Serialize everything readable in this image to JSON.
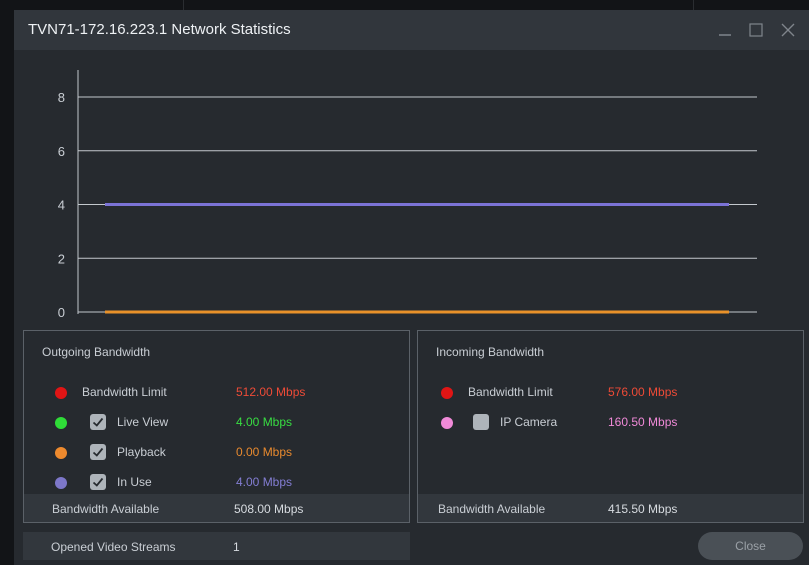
{
  "window": {
    "title": "TVN71-172.16.223.1 Network Statistics",
    "controls": [
      "minimize-icon",
      "maximize-icon",
      "close-icon"
    ]
  },
  "chart_data": {
    "type": "line",
    "x": [
      0,
      1,
      2,
      3,
      4,
      5,
      6,
      7,
      8,
      9,
      10,
      11,
      12,
      13,
      14,
      15,
      16,
      17,
      18,
      19,
      20
    ],
    "ylim": [
      0,
      9
    ],
    "yticks": [
      0,
      2,
      4,
      6,
      8
    ],
    "ytick_labels": [
      "0",
      "2",
      "4",
      "6",
      "8"
    ],
    "grid": true,
    "series": [
      {
        "color": "#7b73d6",
        "values": [
          4,
          4,
          4,
          4,
          4,
          4,
          4,
          4,
          4,
          4,
          4,
          4,
          4,
          4,
          4,
          4,
          4,
          4,
          4,
          4,
          4
        ]
      },
      {
        "color": "#e8912a",
        "values": [
          0,
          0,
          0,
          0,
          0,
          0,
          0,
          0,
          0,
          0,
          0,
          0,
          0,
          0,
          0,
          0,
          0,
          0,
          0,
          0,
          0
        ]
      }
    ]
  },
  "outgoing": {
    "title": "Outgoing Bandwidth",
    "rows": [
      {
        "label": "Bandwidth Limit",
        "value": "512.00 Mbps",
        "dot_color": "#e01515",
        "value_color": "#ee4b37",
        "has_checkbox": false,
        "checked": false
      },
      {
        "label": "Live View",
        "value": "4.00 Mbps",
        "dot_color": "#2fdc38",
        "value_color": "#38de42",
        "has_checkbox": true,
        "checked": true
      },
      {
        "label": "Playback",
        "value": "0.00 Mbps",
        "dot_color": "#ee8a2e",
        "value_color": "#e98a2f",
        "has_checkbox": true,
        "checked": true
      },
      {
        "label": "In Use",
        "value": "4.00 Mbps",
        "dot_color": "#7d77c9",
        "value_color": "#847ed4",
        "has_checkbox": true,
        "checked": true
      }
    ],
    "available_label": "Bandwidth Available",
    "available_value": "508.00 Mbps"
  },
  "incoming": {
    "title": "Incoming Bandwidth",
    "rows": [
      {
        "label": "Bandwidth Limit",
        "value": "576.00 Mbps",
        "dot_color": "#e01515",
        "value_color": "#ee4b37",
        "has_checkbox": false,
        "checked": false
      },
      {
        "label": "IP Camera",
        "value": "160.50 Mbps",
        "dot_color": "#f08ad8",
        "value_color": "#f08ad8",
        "has_checkbox": true,
        "checked": false
      }
    ],
    "available_label": "Bandwidth Available",
    "available_value": "415.50 Mbps"
  },
  "streams": {
    "label": "Opened Video Streams",
    "value": "1"
  },
  "close_button": {
    "label": "Close"
  }
}
